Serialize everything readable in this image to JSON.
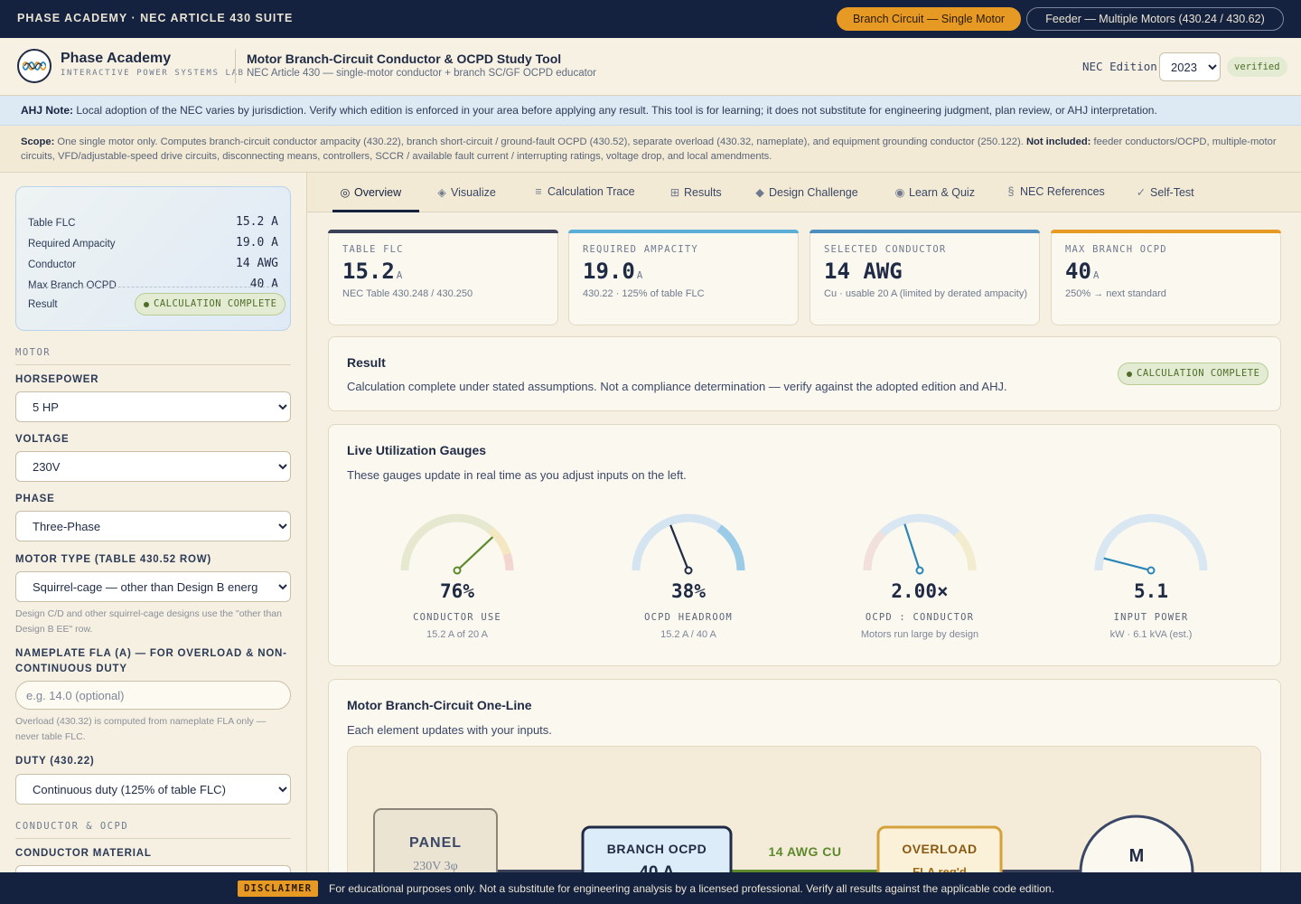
{
  "topbar": {
    "brand": "PHASE ACADEMY · NEC ARTICLE 430 SUITE",
    "mode_single": "Branch Circuit — Single Motor",
    "mode_feeder": "Feeder — Multiple Motors (430.24 / 430.62)"
  },
  "header": {
    "logo_title": "Phase Academy",
    "logo_sub": "INTERACTIVE POWER SYSTEMS LAB",
    "tool_title": "Motor Branch-Circuit Conductor & OCPD Study Tool",
    "tool_sub": "NEC Article 430 — single-motor conductor + branch SC/GF OCPD educator",
    "edition_label": "NEC Edition",
    "edition_value": "2023",
    "verified": "verified"
  },
  "ahj": {
    "label": "AHJ Note:",
    "text": "Local adoption of the NEC varies by jurisdiction. Verify which edition is enforced in your area before applying any result. This tool is for learning; it does not substitute for engineering judgment, plan review, or AHJ interpretation."
  },
  "scope": {
    "label": "Scope:",
    "text": "One single motor only. Computes branch-circuit conductor ampacity (430.22), branch short-circuit / ground-fault OCPD (430.52), separate overload (430.32, nameplate), and equipment grounding conductor (250.122).",
    "excluded_label": "Not included:",
    "excluded_text": "feeder conductors/OCPD, multiple-motor circuits, VFD/adjustable-speed drive circuits, disconnecting means, controllers, SCCR / available fault current / interrupting ratings, voltage drop, and local amendments."
  },
  "summary": {
    "rows": [
      {
        "label": "Table FLC",
        "value": "15.2 A"
      },
      {
        "label": "Required Ampacity",
        "value": "19.0 A"
      },
      {
        "label": "Conductor",
        "value": "14 AWG"
      },
      {
        "label": "Max Branch OCPD",
        "value": "40 A"
      }
    ],
    "result_label": "Result",
    "result_badge": "CALCULATION COMPLETE"
  },
  "form": {
    "motor_section": "MOTOR",
    "horsepower_label": "HORSEPOWER",
    "horsepower_value": "5 HP",
    "voltage_label": "VOLTAGE",
    "voltage_value": "230V",
    "phase_label": "PHASE",
    "phase_value": "Three-Phase",
    "motor_type_label": "MOTOR TYPE (TABLE 430.52 ROW)",
    "motor_type_value": "Squirrel-cage — other than Design B energ",
    "motor_type_help": "Design C/D and other squirrel-cage designs use the \"other than Design B EE\" row.",
    "fla_label": "NAMEPLATE FLA (A) — FOR OVERLOAD & NON-CONTINUOUS DUTY",
    "fla_placeholder": "e.g. 14.0 (optional)",
    "fla_help": "Overload (430.32) is computed from nameplate FLA only — never table FLC.",
    "duty_label": "DUTY (430.22)",
    "duty_value": "Continuous duty (125% of table FLC)",
    "conductor_section": "CONDUCTOR & OCPD",
    "material_label": "CONDUCTOR MATERIAL"
  },
  "tabs": [
    {
      "icon": "◎",
      "label": "Overview"
    },
    {
      "icon": "◈",
      "label": "Visualize"
    },
    {
      "icon": "≡",
      "label": "Calculation Trace"
    },
    {
      "icon": "⊞",
      "label": "Results"
    },
    {
      "icon": "◆",
      "label": "Design Challenge"
    },
    {
      "icon": "◉",
      "label": "Learn & Quiz"
    },
    {
      "icon": "§",
      "label": "NEC References"
    },
    {
      "icon": "✓",
      "label": "Self-Test"
    }
  ],
  "stats": [
    {
      "label": "TABLE FLC",
      "value": "15.2",
      "unit": "A",
      "sub": "NEC Table 430.248 / 430.250",
      "color": "#3a4158"
    },
    {
      "label": "REQUIRED AMPACITY",
      "value": "19.0",
      "unit": "A",
      "sub": "430.22 · 125% of table FLC",
      "color": "#5aaed8"
    },
    {
      "label": "SELECTED CONDUCTOR",
      "value": "14 AWG",
      "unit": "",
      "sub": "Cu · usable 20 A (limited by derated ampacity)",
      "color": "#4d8fbf"
    },
    {
      "label": "MAX BRANCH OCPD",
      "value": "40",
      "unit": "A",
      "sub": "250% → next standard",
      "color": "#e69a24"
    }
  ],
  "result_card": {
    "title": "Result",
    "text": "Calculation complete under stated assumptions. Not a compliance determination — verify against the adopted edition and AHJ.",
    "badge": "CALCULATION COMPLETE"
  },
  "gauges_card": {
    "title": "Live Utilization Gauges",
    "desc": "These gauges update in real time as you adjust inputs on the left.",
    "gauges": [
      {
        "value": "76%",
        "label": "CONDUCTOR USE",
        "sub": "15.2 A of 20 A",
        "fraction": 0.76,
        "needle": "#5d8a2c",
        "arc": "#e6e9cf"
      },
      {
        "value": "38%",
        "label": "OCPD HEADROOM",
        "sub": "15.2 A / 40 A",
        "fraction": 0.38,
        "needle": "#1f2a44",
        "arc": "#d4e5f1"
      },
      {
        "value": "2.00×",
        "label": "OCPD : CONDUCTOR",
        "sub": "Motors run large by design",
        "fraction": 0.4,
        "needle": "#2b86b8",
        "arc": "#d8e7f1"
      },
      {
        "value": "5.1",
        "label": "INPUT POWER",
        "sub": "kW · 6.1 kVA (est.)",
        "fraction": 0.08,
        "needle": "#2b86b8",
        "arc": "#d8e7f1"
      }
    ]
  },
  "oneline": {
    "title": "Motor Branch-Circuit One-Line",
    "desc": "Each element updates with your inputs.",
    "panel_label": "PANEL",
    "panel_sub": "230V 3φ",
    "ocpd_label": "BRANCH OCPD",
    "ocpd_value": "40 A",
    "conductor_label": "14 AWG CU",
    "overload_label": "OVERLOAD",
    "overload_sub": "FLA req'd",
    "motor_label": "M"
  },
  "disclaimer": {
    "badge": "DISCLAIMER",
    "text": "For educational purposes only. Not a substitute for engineering analysis by a licensed professional. Verify all results against the applicable code edition."
  }
}
